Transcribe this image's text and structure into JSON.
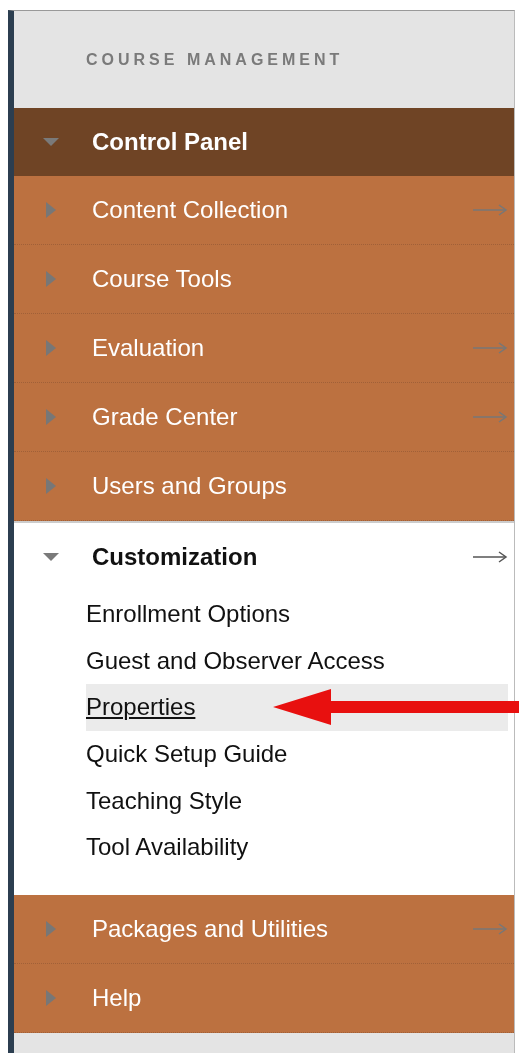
{
  "header": "COURSE MANAGEMENT",
  "control_panel": {
    "label": "Control Panel",
    "expanded": true
  },
  "items": [
    {
      "label": "Content Collection",
      "expanded": false,
      "arrow": true
    },
    {
      "label": "Course Tools",
      "expanded": false,
      "arrow": false
    },
    {
      "label": "Evaluation",
      "expanded": false,
      "arrow": true
    },
    {
      "label": "Grade Center",
      "expanded": false,
      "arrow": true
    },
    {
      "label": "Users and Groups",
      "expanded": false,
      "arrow": false
    },
    {
      "label": "Customization",
      "expanded": true,
      "arrow": true,
      "children": [
        {
          "label": "Enrollment Options",
          "highlighted": false
        },
        {
          "label": "Guest and Observer Access",
          "highlighted": false
        },
        {
          "label": "Properties",
          "highlighted": true
        },
        {
          "label": "Quick Setup Guide",
          "highlighted": false
        },
        {
          "label": "Teaching Style",
          "highlighted": false
        },
        {
          "label": "Tool Availability",
          "highlighted": false
        }
      ]
    },
    {
      "label": "Packages and Utilities",
      "expanded": false,
      "arrow": true
    },
    {
      "label": "Help",
      "expanded": false,
      "arrow": false
    }
  ]
}
